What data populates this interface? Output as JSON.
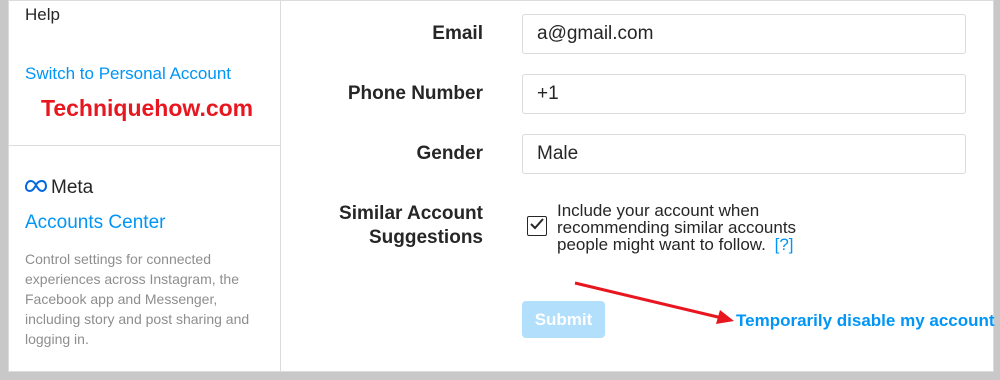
{
  "sidebar": {
    "help_label": "Help",
    "switch_label": "Switch to Personal Account",
    "watermark": "Techniquehow.com",
    "meta_brand": "Meta",
    "accounts_center_label": "Accounts Center",
    "description": "Control settings for connected experiences across Instagram, the Facebook app and Messenger, including story and post sharing and logging in."
  },
  "form": {
    "email_label": "Email",
    "email_value": "a​​​​​​​​@gmail.com",
    "phone_label": "Phone Number",
    "phone_value": "+1",
    "gender_label": "Gender",
    "gender_value": "Male",
    "suggestions_label_line1": "Similar Account",
    "suggestions_label_line2": "Suggestions",
    "suggestions_checked": true,
    "suggestions_text": "Include your account when recommending similar accounts people might want to follow.",
    "suggestions_help": "[?]",
    "submit_label": "Submit",
    "disable_link": "Temporarily disable my account"
  },
  "colors": {
    "accent": "#0095f6",
    "submit_disabled": "#b2dffc",
    "watermark": "#e8171f",
    "arrow": "#e8171f"
  }
}
